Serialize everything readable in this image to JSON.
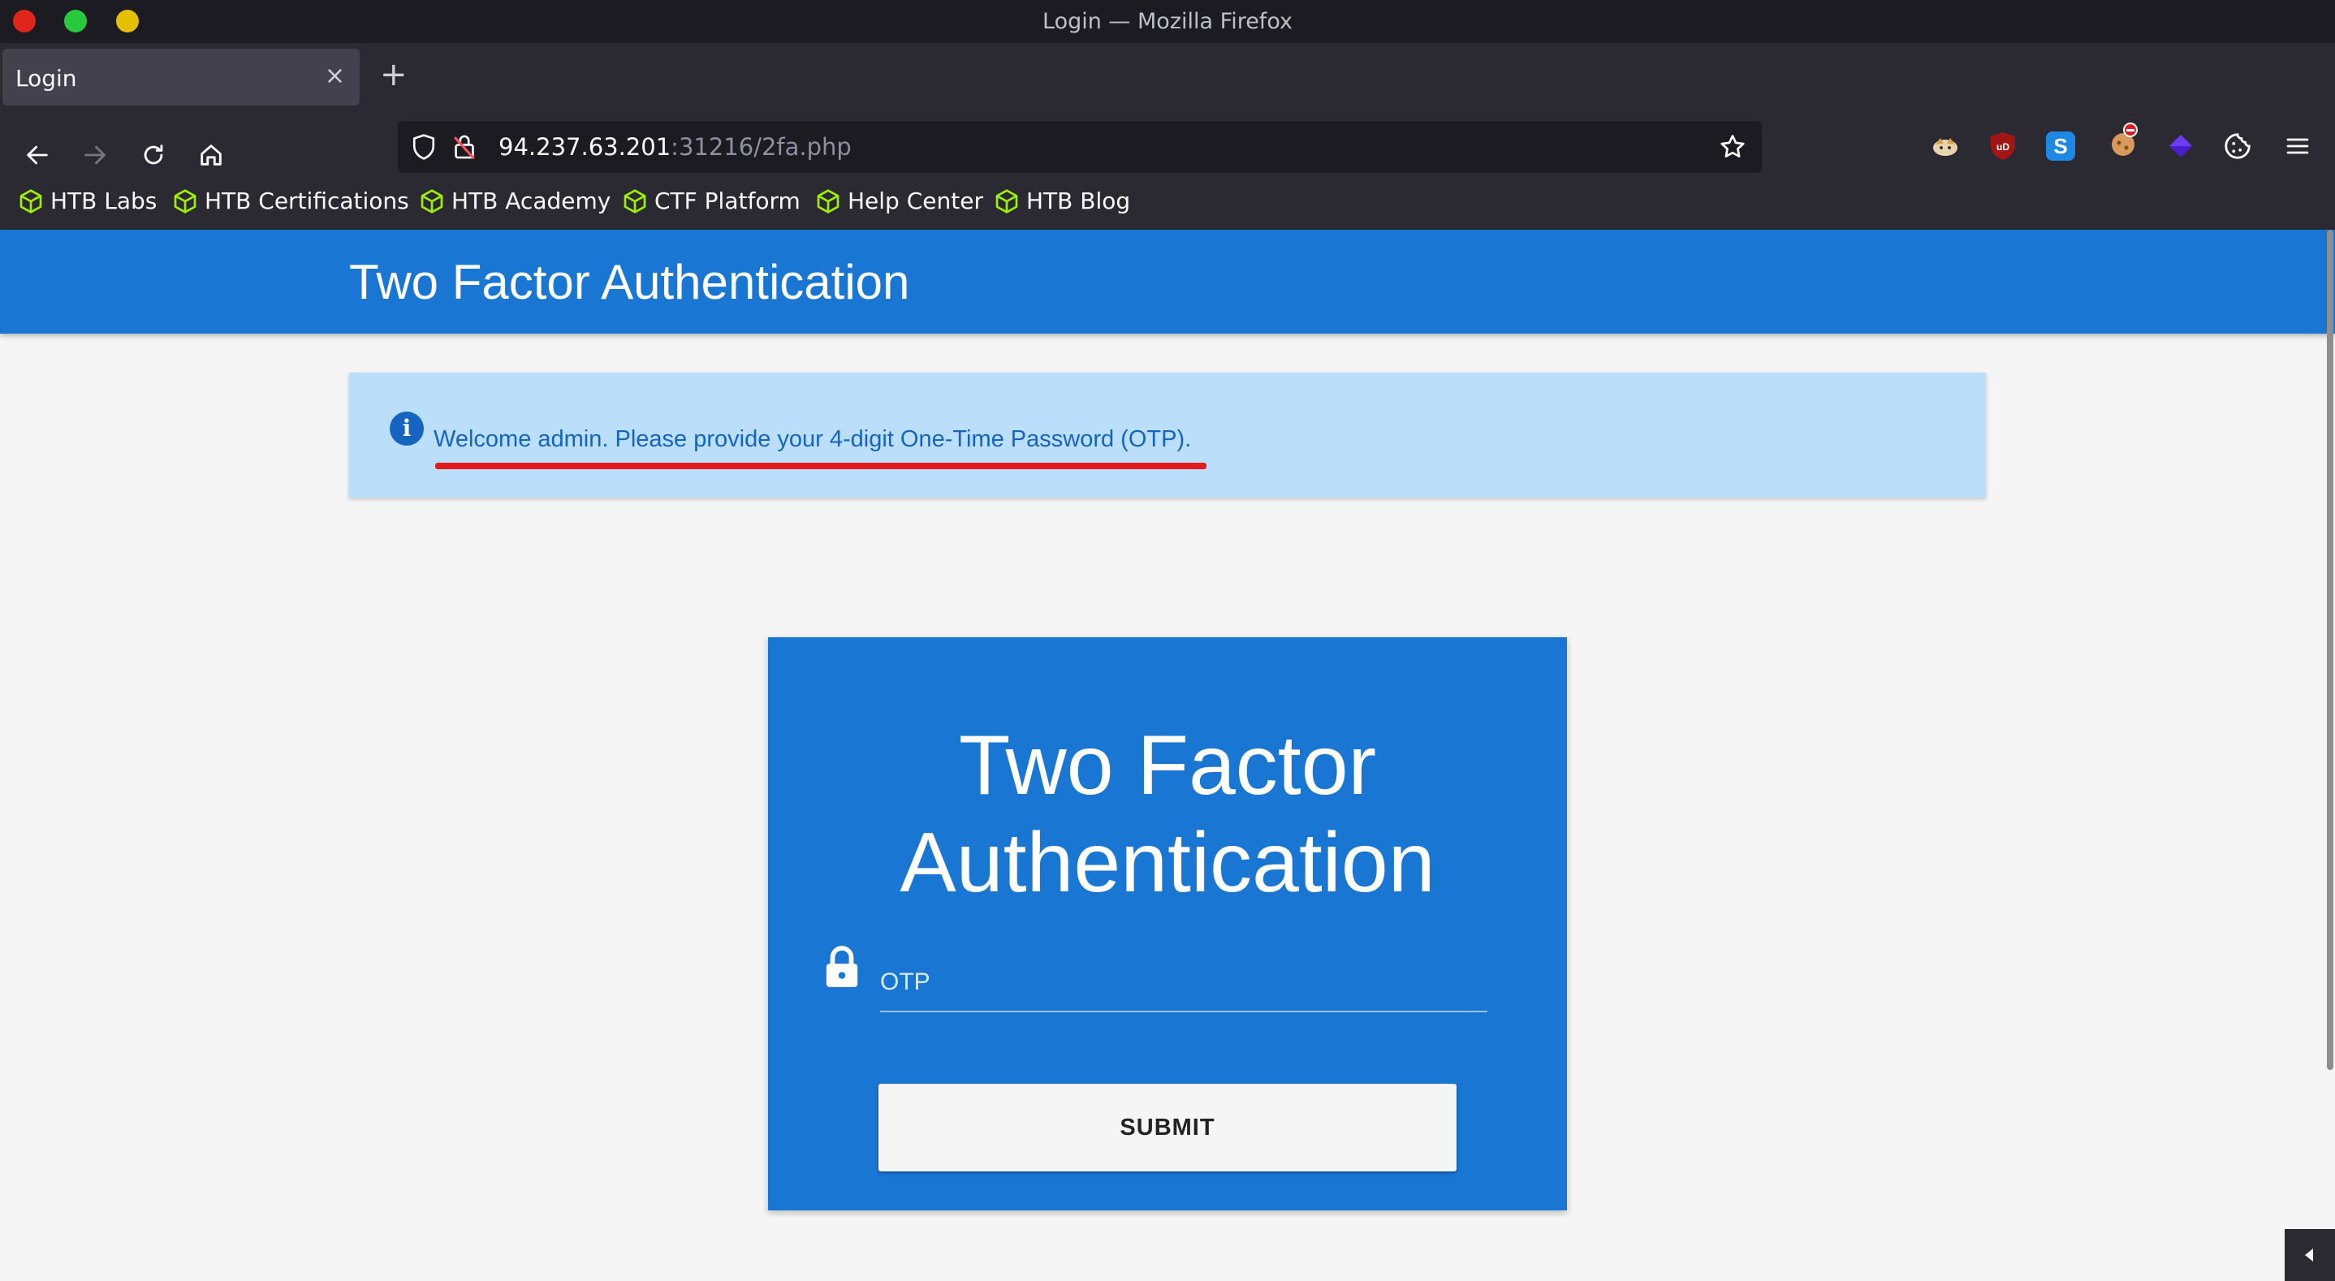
{
  "window": {
    "title": "Login — Mozilla Firefox"
  },
  "tabs": [
    {
      "label": "Login",
      "close": "×"
    }
  ],
  "new_tab": "+",
  "url": {
    "host": "94.237.63.201",
    "rest": ":31216/2fa.php"
  },
  "bookmarks": [
    {
      "label": "HTB Labs"
    },
    {
      "label": "HTB Certifications"
    },
    {
      "label": "HTB Academy"
    },
    {
      "label": "CTF Platform"
    },
    {
      "label": "Help Center"
    },
    {
      "label": "HTB Blog"
    }
  ],
  "extensions": [
    {
      "name": "ublock-origin",
      "text": "uD",
      "color": "#a31515"
    },
    {
      "name": "stylus",
      "text": "S",
      "color": "#1e88e5"
    }
  ],
  "app": {
    "header_title": "Two Factor Authentication"
  },
  "alert": {
    "message": "Welcome admin. Please provide your 4-digit One-Time Password (OTP)."
  },
  "card": {
    "title_line1": "Two Factor",
    "title_line2": "Authentication",
    "otp_placeholder": "OTP",
    "submit_label": "SUBMIT"
  },
  "colors": {
    "primary": "#1976d2",
    "alert_bg": "#bbdefb",
    "alert_text": "#1565c0",
    "underline": "#e41b1b"
  }
}
